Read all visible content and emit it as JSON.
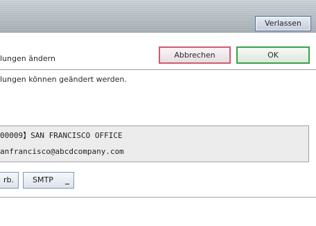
{
  "header": {
    "exit_label": "Verlassen"
  },
  "title_bar": {
    "title": "lungen ändern",
    "cancel_label": "Abbrechen",
    "ok_label": "OK"
  },
  "info": {
    "message": "lungen können geändert werden."
  },
  "destination": {
    "name": "00009】SAN FRANCISCO OFFICE",
    "email": "anfrancisco@abcdcompany.com"
  },
  "actions": {
    "prev_label": "rb.",
    "smtp_label": "SMTP"
  }
}
